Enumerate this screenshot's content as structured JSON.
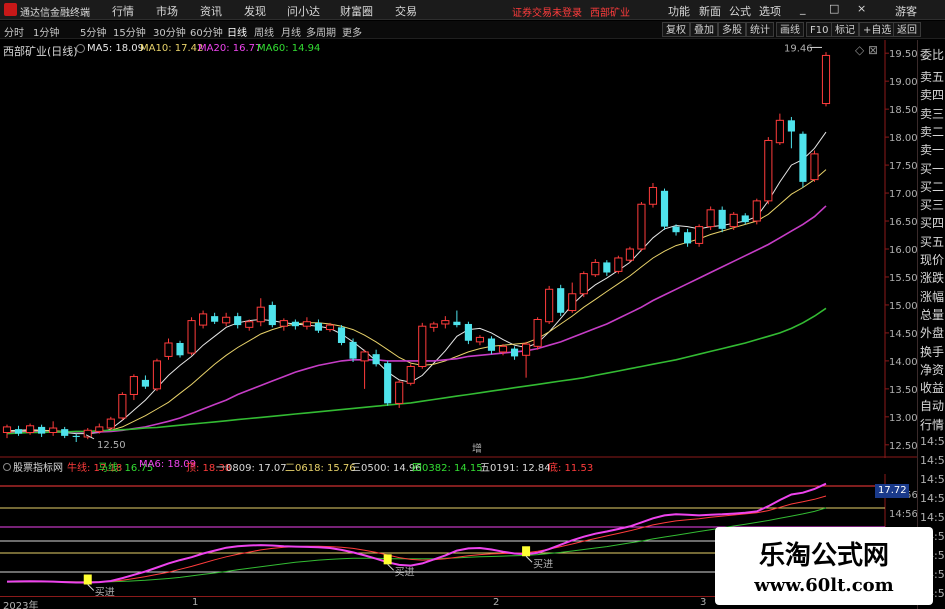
{
  "app": {
    "title": "通达信金融终端",
    "menu": [
      "行情",
      "市场",
      "资讯",
      "发现",
      "问小达",
      "财富圈",
      "交易"
    ],
    "status_login": "证券交易未登录",
    "status_stock": "西部矿业",
    "right_menu": [
      "功能",
      "新面",
      "公式",
      "选项"
    ],
    "window_buttons": [
      "_",
      "□",
      "×"
    ],
    "guest": "游客"
  },
  "toolbar": {
    "periods": [
      "分时",
      "1分钟",
      "5分钟",
      "15分钟",
      "30分钟",
      "60分钟",
      "日线",
      "周线",
      "月线",
      "多周期",
      "更多"
    ],
    "active_period": "日线",
    "buttons": [
      "复权",
      "叠加",
      "多股",
      "统计",
      "画线",
      "F10",
      "标记",
      "+自选",
      "返回"
    ]
  },
  "main_chart": {
    "stock": "西部矿业(日线)",
    "ma_legend": [
      {
        "label": "MA5: 18.09",
        "color": "#e6e6e6"
      },
      {
        "label": "MA10: 17.42",
        "color": "#e8d26a"
      },
      {
        "label": "MA20: 16.77",
        "color": "#ee44ee"
      },
      {
        "label": "MA60: 14.94",
        "color": "#33dd33"
      }
    ],
    "high_marker": "19.46",
    "low_marker": "12.50",
    "center_marker": "增",
    "price_axis": [
      "19.50",
      "19.00",
      "18.50",
      "18.00",
      "17.50",
      "17.00",
      "16.50",
      "16.00",
      "15.50",
      "15.00",
      "14.50",
      "14.00",
      "13.50",
      "13.00",
      "12.50"
    ]
  },
  "indicator": {
    "name": "股票指标网",
    "labels": [
      {
        "text": "牛线: 17.18",
        "color": "#ff3c3c"
      },
      {
        "text": "马线: 16.75",
        "color": "#33dd33"
      },
      {
        "text": "MA6: 18.09",
        "color": "#ee44ee"
      },
      {
        "text": "顶: 18.38",
        "color": "#ff3c3c"
      },
      {
        "text": "一0809: 17.07",
        "color": "#d8d8d8"
      },
      {
        "text": "二0618: 15.76",
        "color": "#e8d26a"
      },
      {
        "text": "三0500: 14.96",
        "color": "#d8d8d8"
      },
      {
        "text": "四0382: 14.15",
        "color": "#33dd33"
      },
      {
        "text": "五0191: 12.84",
        "color": "#d8d8d8"
      },
      {
        "text": "底: 11.53",
        "color": "#ff3c3c"
      }
    ],
    "value_box": "17.72",
    "buy_labels": [
      "买进",
      "买进",
      "买进"
    ],
    "sub_axis": [
      "14:56",
      "14:56",
      "14:56",
      "14:56",
      "14:56",
      "14:56"
    ]
  },
  "date_axis": [
    "2023年",
    "1",
    "2",
    "3"
  ],
  "sidebar": {
    "top_label": "委比",
    "items": [
      "卖五",
      "卖四",
      "卖三",
      "卖二",
      "卖一",
      "买一",
      "买二",
      "买三",
      "买四",
      "买五",
      "现价",
      "涨跌",
      "涨幅",
      "总量",
      "外盘",
      "换手",
      "净资",
      "收益",
      "自动",
      "行情"
    ],
    "time_labels": [
      "14:56",
      "14:56",
      "14:55",
      "14:55",
      "14:55",
      "14:55",
      "14:55",
      "14:55",
      "14:56"
    ]
  },
  "watermark": {
    "title": "乐淘公式网",
    "url": "www.60lt.com"
  },
  "chart_data": {
    "type": "candlestick",
    "ylim": [
      12.3,
      19.7
    ],
    "candles": [
      [
        12.72,
        12.82,
        12.62,
        12.86
      ],
      [
        12.78,
        12.7,
        12.66,
        12.84
      ],
      [
        12.72,
        12.84,
        12.68,
        12.88
      ],
      [
        12.82,
        12.7,
        12.64,
        12.86
      ],
      [
        12.72,
        12.8,
        12.66,
        12.92
      ],
      [
        12.78,
        12.66,
        12.62,
        12.82
      ],
      [
        12.66,
        12.64,
        12.55,
        12.7
      ],
      [
        12.64,
        12.76,
        12.6,
        12.8
      ],
      [
        12.74,
        12.82,
        12.7,
        12.88
      ],
      [
        12.8,
        12.96,
        12.76,
        13.0
      ],
      [
        12.98,
        13.4,
        12.94,
        13.44
      ],
      [
        13.4,
        13.72,
        13.3,
        13.76
      ],
      [
        13.66,
        13.54,
        13.5,
        13.74
      ],
      [
        13.5,
        14.0,
        13.46,
        14.04
      ],
      [
        14.08,
        14.32,
        14.02,
        14.4
      ],
      [
        14.32,
        14.1,
        14.06,
        14.36
      ],
      [
        14.14,
        14.72,
        14.1,
        14.78
      ],
      [
        14.64,
        14.84,
        14.58,
        14.9
      ],
      [
        14.8,
        14.7,
        14.66,
        14.86
      ],
      [
        14.68,
        14.78,
        14.62,
        14.86
      ],
      [
        14.8,
        14.64,
        14.58,
        14.86
      ],
      [
        14.6,
        14.7,
        14.54,
        14.74
      ],
      [
        14.7,
        14.96,
        14.62,
        15.12
      ],
      [
        15.0,
        14.64,
        14.6,
        15.06
      ],
      [
        14.62,
        14.72,
        14.54,
        14.76
      ],
      [
        14.7,
        14.62,
        14.56,
        14.74
      ],
      [
        14.62,
        14.7,
        14.56,
        14.78
      ],
      [
        14.68,
        14.54,
        14.5,
        14.74
      ],
      [
        14.56,
        14.64,
        14.52,
        14.68
      ],
      [
        14.6,
        14.32,
        14.28,
        14.64
      ],
      [
        14.34,
        14.04,
        13.98,
        14.4
      ],
      [
        14.0,
        14.16,
        13.5,
        14.2
      ],
      [
        14.12,
        13.94,
        13.9,
        14.2
      ],
      [
        13.96,
        13.24,
        13.2,
        14.0
      ],
      [
        13.24,
        13.62,
        13.16,
        13.66
      ],
      [
        13.6,
        13.9,
        13.56,
        13.94
      ],
      [
        13.9,
        14.62,
        13.86,
        14.68
      ],
      [
        14.6,
        14.66,
        14.52,
        14.7
      ],
      [
        14.66,
        14.72,
        14.58,
        14.8
      ],
      [
        14.7,
        14.64,
        14.6,
        14.9
      ],
      [
        14.66,
        14.36,
        14.3,
        14.7
      ],
      [
        14.34,
        14.42,
        14.28,
        14.46
      ],
      [
        14.4,
        14.18,
        14.12,
        14.44
      ],
      [
        14.16,
        14.26,
        14.1,
        14.3
      ],
      [
        14.22,
        14.08,
        14.02,
        14.26
      ],
      [
        14.1,
        14.3,
        13.7,
        14.34
      ],
      [
        14.26,
        14.74,
        14.2,
        14.78
      ],
      [
        14.7,
        15.28,
        14.66,
        15.34
      ],
      [
        15.3,
        14.86,
        14.8,
        15.36
      ],
      [
        14.9,
        15.2,
        14.86,
        15.4
      ],
      [
        15.2,
        15.56,
        15.14,
        15.6
      ],
      [
        15.54,
        15.76,
        15.5,
        15.82
      ],
      [
        15.76,
        15.58,
        15.52,
        15.8
      ],
      [
        15.6,
        15.84,
        15.56,
        15.88
      ],
      [
        15.8,
        16.0,
        15.76,
        16.04
      ],
      [
        16.0,
        16.8,
        15.96,
        16.84
      ],
      [
        16.8,
        17.1,
        16.74,
        17.18
      ],
      [
        17.04,
        16.4,
        16.34,
        17.08
      ],
      [
        16.4,
        16.3,
        16.24,
        16.44
      ],
      [
        16.3,
        16.1,
        16.04,
        16.36
      ],
      [
        16.1,
        16.4,
        16.04,
        16.44
      ],
      [
        16.4,
        16.7,
        16.34,
        16.76
      ],
      [
        16.7,
        16.36,
        16.3,
        16.76
      ],
      [
        16.4,
        16.62,
        16.34,
        16.66
      ],
      [
        16.6,
        16.48,
        16.44,
        16.64
      ],
      [
        16.5,
        16.86,
        16.44,
        16.9
      ],
      [
        16.86,
        17.94,
        16.8,
        18.0
      ],
      [
        17.9,
        18.3,
        17.86,
        18.42
      ],
      [
        18.3,
        18.1,
        17.8,
        18.36
      ],
      [
        18.06,
        17.2,
        17.1,
        18.1
      ],
      [
        17.24,
        17.7,
        17.2,
        17.76
      ],
      [
        18.6,
        19.46,
        18.55,
        19.52
      ]
    ],
    "ma_series": [
      {
        "name": "MA5",
        "values": [
          12.75,
          12.76,
          12.77,
          12.76,
          12.75,
          12.72,
          12.7,
          12.7,
          12.72,
          12.78,
          12.94,
          13.12,
          13.3,
          13.52,
          13.74,
          13.92,
          14.08,
          14.28,
          14.44,
          14.6,
          14.68,
          14.72,
          14.74,
          14.72,
          14.68,
          14.66,
          14.64,
          14.62,
          14.58,
          14.48,
          14.34,
          14.18,
          14.0,
          13.8,
          13.66,
          13.62,
          13.74,
          13.96,
          14.18,
          14.44,
          14.56,
          14.58,
          14.5,
          14.38,
          14.28,
          14.24,
          14.32,
          14.52,
          14.76,
          15.0,
          15.2,
          15.36,
          15.48,
          15.62,
          15.76,
          15.98,
          16.2,
          16.36,
          16.42,
          16.4,
          16.36,
          16.4,
          16.42,
          16.46,
          16.5,
          16.58,
          16.86,
          17.2,
          17.5,
          17.6,
          17.8,
          18.09
        ]
      },
      {
        "name": "MA10",
        "values": [
          12.74,
          12.74,
          12.75,
          12.75,
          12.75,
          12.74,
          12.73,
          12.73,
          12.74,
          12.76,
          12.82,
          12.92,
          13.02,
          13.14,
          13.26,
          13.42,
          13.58,
          13.76,
          13.94,
          14.1,
          14.24,
          14.36,
          14.48,
          14.56,
          14.62,
          14.66,
          14.68,
          14.68,
          14.66,
          14.62,
          14.56,
          14.46,
          14.34,
          14.2,
          14.06,
          13.96,
          13.92,
          13.94,
          14.0,
          14.08,
          14.16,
          14.22,
          14.26,
          14.28,
          14.3,
          14.32,
          14.4,
          14.52,
          14.66,
          14.8,
          14.96,
          15.1,
          15.24,
          15.38,
          15.52,
          15.68,
          15.84,
          15.96,
          16.06,
          16.12,
          16.18,
          16.26,
          16.32,
          16.38,
          16.44,
          16.5,
          16.62,
          16.8,
          16.98,
          17.1,
          17.24,
          17.42
        ]
      },
      {
        "name": "MA20",
        "values": [
          12.72,
          12.72,
          12.73,
          12.73,
          12.73,
          12.73,
          12.73,
          12.73,
          12.73,
          12.74,
          12.76,
          12.79,
          12.82,
          12.87,
          12.92,
          12.98,
          13.06,
          13.14,
          13.22,
          13.3,
          13.4,
          13.48,
          13.56,
          13.64,
          13.72,
          13.8,
          13.86,
          13.92,
          13.96,
          14.0,
          14.02,
          14.02,
          14.02,
          14.0,
          14.0,
          14.0,
          14.0,
          14.0,
          14.02,
          14.04,
          14.08,
          14.1,
          14.12,
          14.14,
          14.16,
          14.18,
          14.22,
          14.28,
          14.34,
          14.42,
          14.5,
          14.58,
          14.66,
          14.76,
          14.86,
          14.96,
          15.08,
          15.18,
          15.28,
          15.38,
          15.48,
          15.58,
          15.68,
          15.78,
          15.88,
          15.98,
          16.08,
          16.2,
          16.32,
          16.44,
          16.58,
          16.77
        ]
      },
      {
        "name": "MA60",
        "values": [
          12.7,
          12.71,
          12.72,
          12.72,
          12.73,
          12.73,
          12.74,
          12.74,
          12.75,
          12.76,
          12.77,
          12.78,
          12.8,
          12.81,
          12.83,
          12.85,
          12.87,
          12.89,
          12.91,
          12.93,
          12.95,
          12.97,
          12.99,
          13.01,
          13.03,
          13.05,
          13.07,
          13.09,
          13.11,
          13.13,
          13.15,
          13.17,
          13.19,
          13.21,
          13.23,
          13.25,
          13.28,
          13.31,
          13.34,
          13.37,
          13.4,
          13.43,
          13.46,
          13.49,
          13.52,
          13.55,
          13.58,
          13.61,
          13.64,
          13.67,
          13.7,
          13.74,
          13.78,
          13.82,
          13.86,
          13.9,
          13.94,
          13.98,
          14.02,
          14.07,
          14.12,
          14.17,
          14.22,
          14.27,
          14.32,
          14.38,
          14.44,
          14.5,
          14.58,
          14.68,
          14.8,
          14.94
        ]
      }
    ]
  }
}
